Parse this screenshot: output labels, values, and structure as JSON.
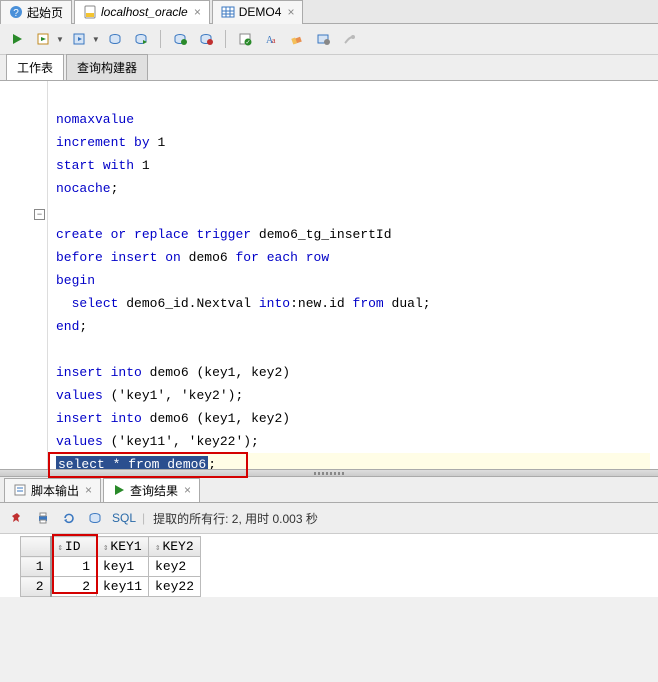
{
  "tabs": {
    "start_page": "起始页",
    "worksheet": "localhost_oracle",
    "demo4": "DEMO4"
  },
  "subtabs": {
    "worksheet": "工作表",
    "query_builder": "查询构建器"
  },
  "code": {
    "l1": "",
    "l2": "nomaxvalue",
    "l3_a": "increment",
    "l3_b": "by",
    "l3_c": "1",
    "l4_a": "start",
    "l4_b": "with",
    "l4_c": "1",
    "l5_a": "nocache",
    "l5_semi": ";",
    "l6": "",
    "l7_a": "create",
    "l7_b": "or",
    "l7_c": "replace",
    "l7_d": "trigger",
    "l7_e": "demo6_tg_insertId",
    "l8_a": "before",
    "l8_b": "insert",
    "l8_c": "on",
    "l8_d": "demo6",
    "l8_e": "for",
    "l8_f": "each",
    "l8_g": "row",
    "l9_a": "begin",
    "l10_a": "select",
    "l10_b": "demo6_id.Nextval",
    "l10_c": "into",
    "l10_d": ":new.id",
    "l10_e": "from",
    "l10_f": "dual;",
    "l11_a": "end",
    "l11_semi": ";",
    "l12": "",
    "l13_a": "insert",
    "l13_b": "into",
    "l13_c": "demo6 (key1, key2)",
    "l14_a": "values",
    "l14_b": "('key1', 'key2');",
    "l15_a": "insert",
    "l15_b": "into",
    "l15_c": "demo6 (key1, key2)",
    "l16_a": "values",
    "l16_b": "('key11', 'key22');",
    "l17": "",
    "l18_a": "select * from demo6",
    "l18_semi": ";"
  },
  "result_tabs": {
    "script_output": "脚本输出",
    "query_result": "查询结果"
  },
  "result_toolbar": {
    "sql_label": "SQL",
    "status": "提取的所有行: 2, 用时 0.003 秒"
  },
  "grid": {
    "headers": {
      "id": "ID",
      "key1": "KEY1",
      "key2": "KEY2"
    },
    "rows": [
      {
        "n": "1",
        "id": "1",
        "key1": "key1",
        "key2": "key2"
      },
      {
        "n": "2",
        "id": "2",
        "key1": "key11",
        "key2": "key22"
      }
    ]
  }
}
